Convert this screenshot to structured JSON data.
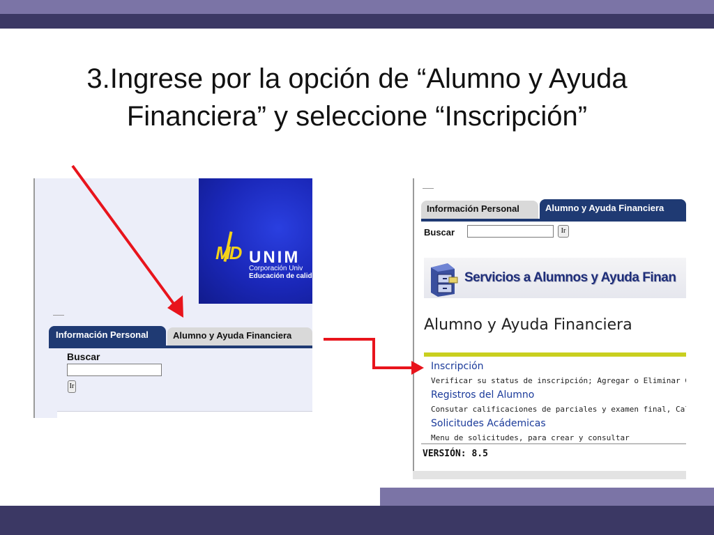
{
  "slide": {
    "title_line1": "3.Ingrese por la opción de “Alumno y Ayuda",
    "title_line2": "Financiera” y seleccione  “Inscripción”"
  },
  "left_screenshot": {
    "logo": {
      "mark": "MD",
      "name": "UNIM",
      "subtitle1": "Corporación Univ",
      "subtitle2": "Educación de calid"
    },
    "tabs": [
      "Información Personal",
      "Alumno y Ayuda Financiera"
    ],
    "search": {
      "label": "Buscar",
      "value": "",
      "go_label": "Ir"
    }
  },
  "right_screenshot": {
    "tabs": [
      "Información Personal",
      "Alumno y Ayuda Financiera"
    ],
    "search": {
      "label": "Buscar",
      "value": "",
      "go_label": "Ir"
    },
    "services_banner": {
      "title": "Servicios a Alumnos y Ayuda Finan",
      "icon": "file-cabinet-icon"
    },
    "page_heading": "Alumno y Ayuda Financiera",
    "menu": [
      {
        "label": "Inscripción",
        "description": "Verificar su status de inscripción; Agregar o Eliminar Clases; S"
      },
      {
        "label": "Registros del Alumno",
        "description": "Consutar calificaciones de parciales y examen final, Calificacio"
      },
      {
        "label": "Solicitudes Acádemicas",
        "description": "Menu de solicitudes, para crear y consultar"
      }
    ],
    "version": "VERSIÓN: 8.5"
  },
  "colors": {
    "band_light": "#7b74a6",
    "band_dark": "#3b3864",
    "tab_active": "#1f3a73",
    "link": "#1a3a9a",
    "accent_yellow": "#c9cf1f",
    "arrow": "#e8141c"
  },
  "icons": [
    "arrow-icon",
    "file-cabinet-icon"
  ]
}
